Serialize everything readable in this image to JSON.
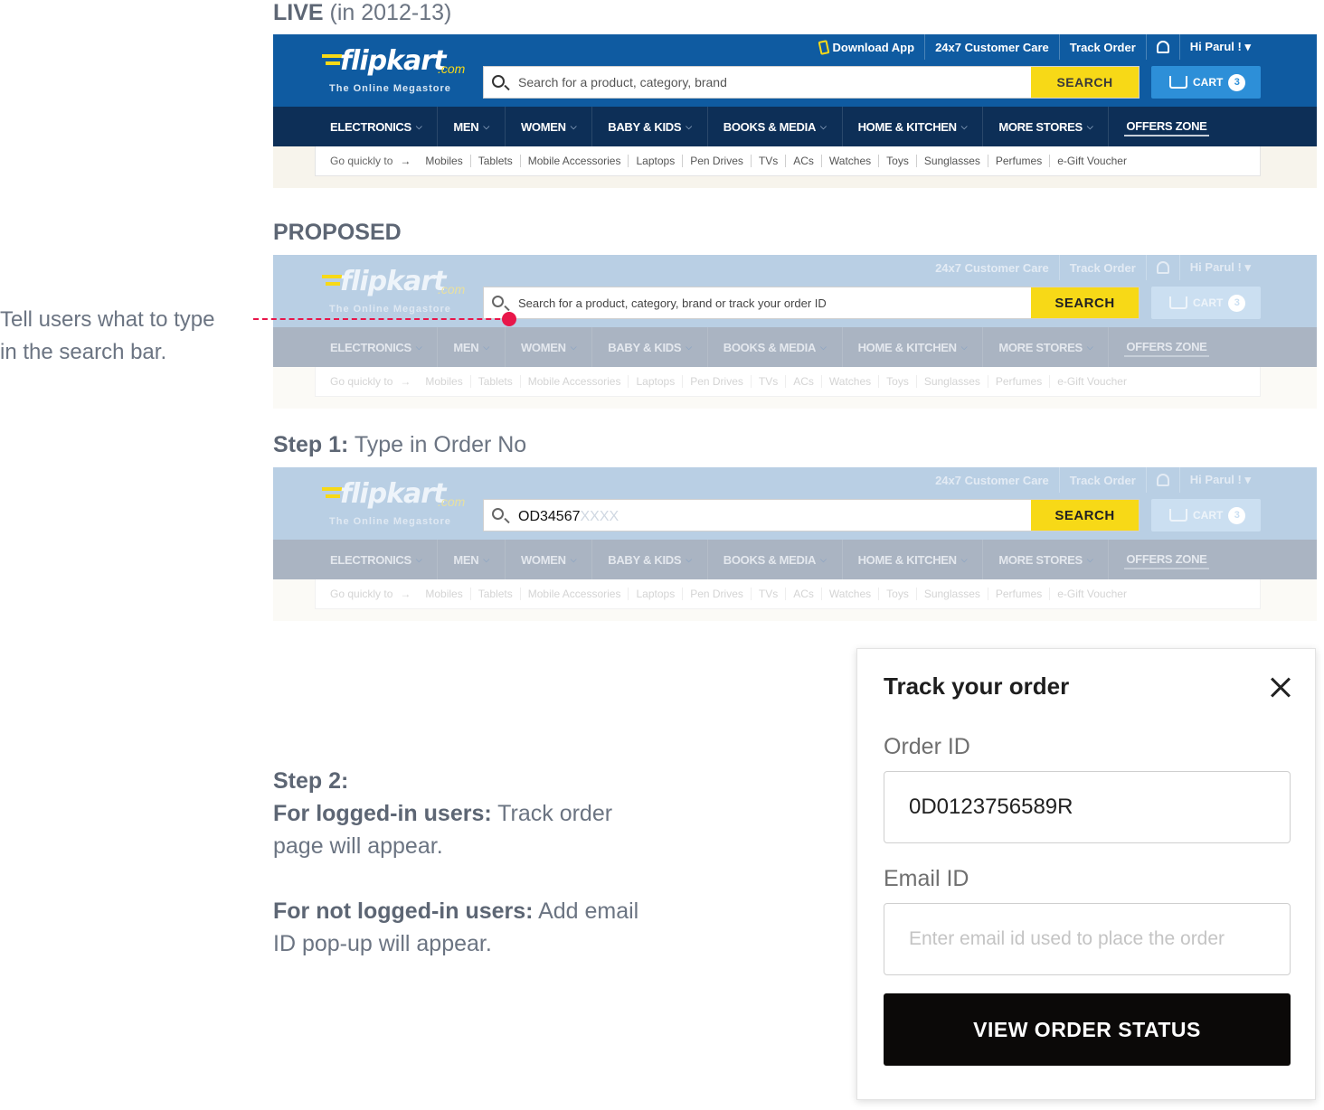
{
  "sections": {
    "live_title_bold": "LIVE",
    "live_title_rest": " (in 2012-13)",
    "proposed_title": "PROPOSED",
    "step1_bold": "Step 1:",
    "step1_rest": " Type in Order No"
  },
  "annotation": {
    "line1": "Tell users what to type",
    "line2": "in the search bar.",
    "color": "#e8164a"
  },
  "flipkart": {
    "logo_word": "flipkart",
    "logo_com": ".com",
    "tagline": "The Online Megastore",
    "top_links": {
      "download_app": "Download App",
      "customer_care": "24x7 Customer Care",
      "track_order": "Track Order",
      "user": "Hi Parul ! ▾"
    },
    "search_button": "SEARCH",
    "cart_label": "CART",
    "cart_count": "3",
    "nav": [
      "ELECTRONICS",
      "MEN",
      "WOMEN",
      "BABY & KIDS",
      "BOOKS & MEDIA",
      "HOME & KITCHEN",
      "MORE STORES"
    ],
    "offers": "OFFERS ZONE",
    "quick_label": "Go quickly to",
    "quick_links": [
      "Mobiles",
      "Tablets",
      "Mobile Accessories",
      "Laptops",
      "Pen Drives",
      "TVs",
      "ACs",
      "Watches",
      "Toys",
      "Sunglasses",
      "Perfumes",
      "e-Gift Voucher"
    ],
    "colors": {
      "header_blue": "#0f5ba1",
      "nav_navy": "#0d2f57",
      "search_yellow": "#f7d917",
      "cart_blue": "#2d8fd8"
    }
  },
  "live_search_placeholder": "Search for a product, category, brand",
  "proposed_search_placeholder": "Search for a product, category, brand or track your order ID",
  "step1_search_typed": "OD34567",
  "step1_search_ghost": "XXXX",
  "step2": {
    "heading": "Step 2:",
    "logged_in_bold": "For logged-in users:",
    "logged_in_rest": " Track order page will appear.",
    "not_logged_bold": "For not logged-in users:",
    "not_logged_rest": " Add email ID pop-up will appear."
  },
  "modal": {
    "title": "Track your order",
    "order_label": "Order ID",
    "order_value": "0D0123756589R",
    "email_label": "Email ID",
    "email_placeholder": "Enter email id used to place the order",
    "button": "VIEW ORDER STATUS"
  }
}
